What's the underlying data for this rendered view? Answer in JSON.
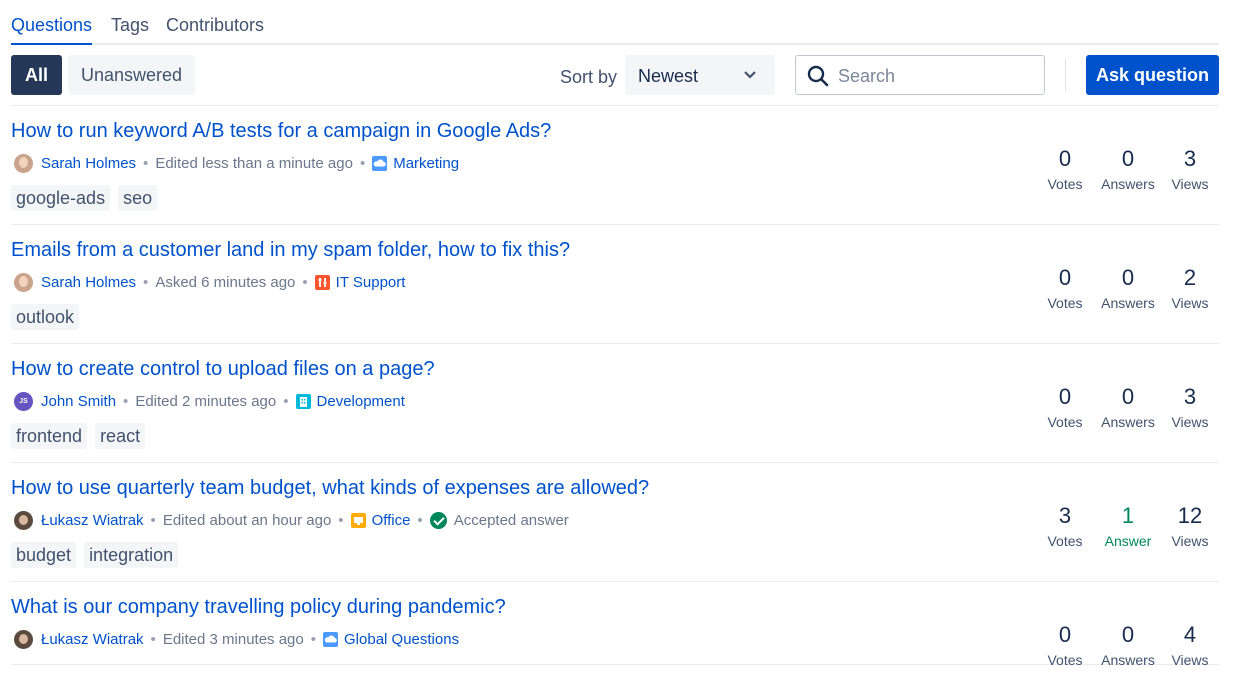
{
  "tabs": [
    {
      "label": "Questions",
      "active": true
    },
    {
      "label": "Tags",
      "active": false
    },
    {
      "label": "Contributors",
      "active": false
    }
  ],
  "toolbar": {
    "filter_all": "All",
    "filter_unanswered": "Unanswered",
    "sort_label": "Sort by",
    "sort_value": "Newest",
    "search_placeholder": "Search",
    "ask_button": "Ask question"
  },
  "colors": {
    "primary": "#0052cc",
    "dark": "#253858",
    "success": "#00875a"
  },
  "questions": [
    {
      "title": "How to run keyword A/B tests for a campaign in Google Ads?",
      "author": "Sarah Holmes",
      "avatar": "sarah",
      "activity": "Edited less than a minute ago",
      "space": "Marketing",
      "space_icon": "cloud-space-icon",
      "accepted": "",
      "tags": [
        "google-ads",
        "seo"
      ],
      "votes": "0",
      "votes_label": "Votes",
      "answers": "0",
      "answers_label": "Answers",
      "views": "3",
      "views_label": "Views"
    },
    {
      "title": "Emails from a customer land in my spam folder, how to fix this?",
      "author": "Sarah Holmes",
      "avatar": "sarah",
      "activity": "Asked 6 minutes ago",
      "space": "IT Support",
      "space_icon": "tools-space-icon",
      "accepted": "",
      "tags": [
        "outlook"
      ],
      "votes": "0",
      "votes_label": "Votes",
      "answers": "0",
      "answers_label": "Answers",
      "views": "2",
      "views_label": "Views"
    },
    {
      "title": "How to create control to upload files on a page?",
      "author": "John Smith",
      "avatar": "john",
      "avatar_initials": "JS",
      "activity": "Edited 2 minutes ago",
      "space": "Development",
      "space_icon": "building-space-icon",
      "accepted": "",
      "tags": [
        "frontend",
        "react"
      ],
      "votes": "0",
      "votes_label": "Votes",
      "answers": "0",
      "answers_label": "Answers",
      "views": "3",
      "views_label": "Views"
    },
    {
      "title": "How to use quarterly team budget, what kinds of expenses are allowed?",
      "author": "Łukasz Wiatrak",
      "avatar": "lukasz",
      "activity": "Edited about an hour ago",
      "space": "Office",
      "space_icon": "office-space-icon",
      "accepted": "Accepted answer",
      "tags": [
        "budget",
        "integration"
      ],
      "votes": "3",
      "votes_label": "Votes",
      "answers": "1",
      "answers_label": "Answer",
      "views": "12",
      "views_label": "Views"
    },
    {
      "title": "What is our company travelling policy during pandemic?",
      "author": "Łukasz Wiatrak",
      "avatar": "lukasz",
      "activity": "Edited 3 minutes ago",
      "space": "Global Questions",
      "space_icon": "cloud-space-icon",
      "accepted": "",
      "tags": [],
      "votes": "0",
      "votes_label": "Votes",
      "answers": "0",
      "answers_label": "Answers",
      "views": "4",
      "views_label": "Views"
    }
  ]
}
